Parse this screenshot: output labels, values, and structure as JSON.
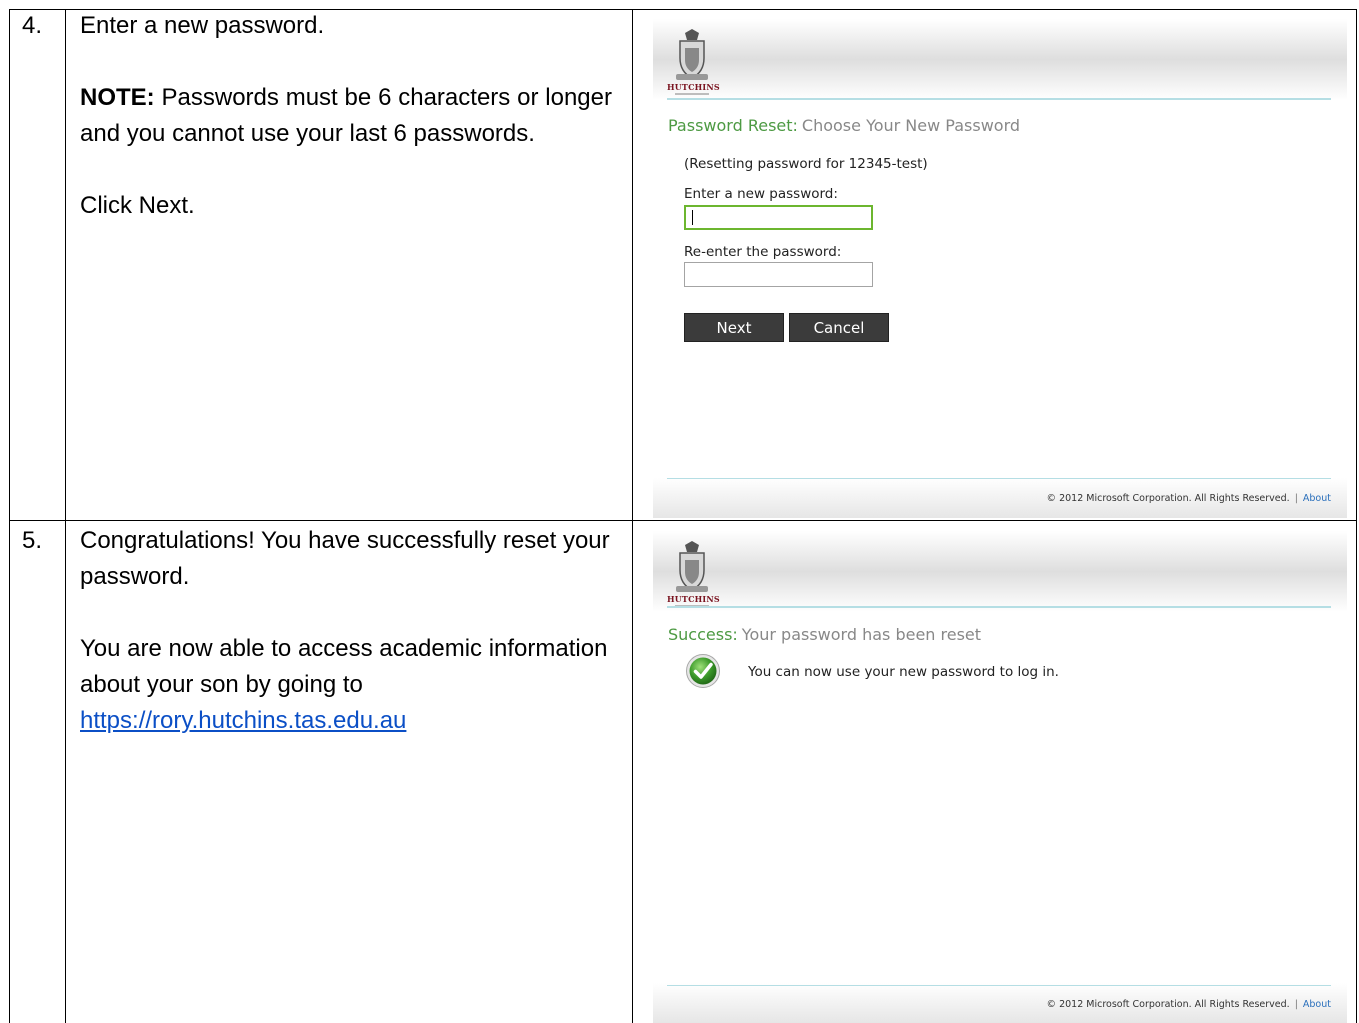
{
  "step4": {
    "number": "4.",
    "line1": "Enter a new password.",
    "note_label": "NOTE:",
    "note_text": " Passwords must be 6 characters or longer and you cannot use your last 6 passwords.",
    "click": "Click Next.",
    "screenshot": {
      "logo_text": "HUTCHINS",
      "heading_label": "Password Reset:",
      "heading_desc": "Choose Your New Password",
      "resetting_for": "(Resetting password for 12345-test)",
      "new_password_label": "Enter a new password:",
      "reenter_label": "Re-enter the password:",
      "next_button": "Next",
      "cancel_button": "Cancel",
      "footer_copyright": "© 2012 Microsoft Corporation. All Rights Reserved.",
      "footer_separator": "|",
      "footer_about": "About"
    }
  },
  "step5": {
    "number": "5.",
    "line1": "Congratulations!  You have successfully reset your password.",
    "line2": "You are now able to access academic information about your son by going to",
    "link": "https://rory.hutchins.tas.edu.au",
    "screenshot": {
      "logo_text": "HUTCHINS",
      "heading_label": "Success:",
      "heading_desc": "Your password has been reset",
      "message": "You can now use your new password to log in.",
      "footer_copyright": "© 2012 Microsoft Corporation. All Rights Reserved.",
      "footer_separator": "|",
      "footer_about": "About"
    }
  },
  "colors": {
    "heading_green": "#4d9a43",
    "focus_green": "#6cb62f",
    "divider_blue": "#b5dee4",
    "link_blue": "#0b4fc6",
    "logo_maroon": "#7a1420"
  }
}
